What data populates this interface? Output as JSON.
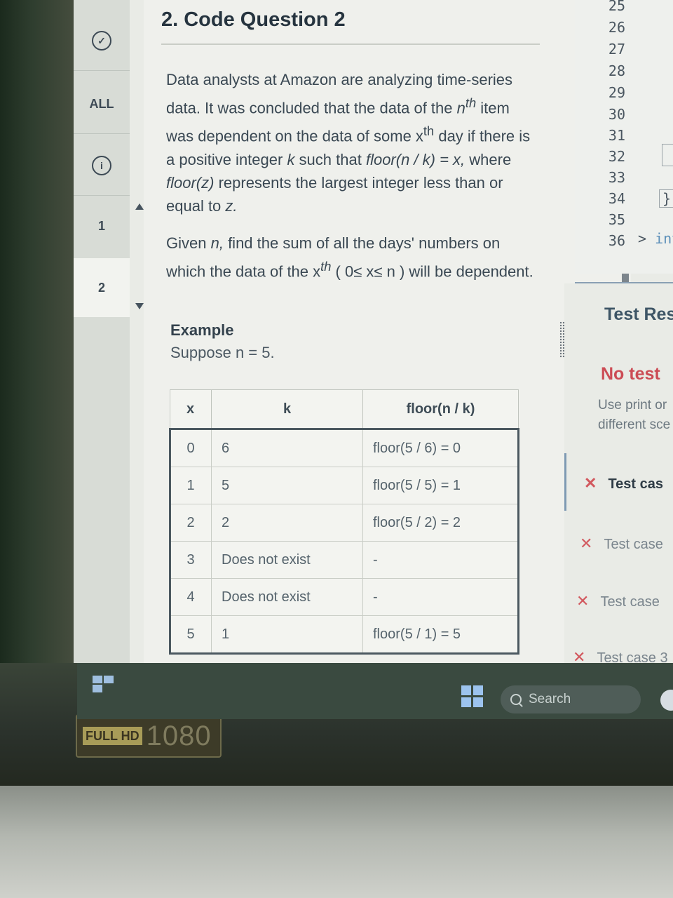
{
  "nav": {
    "all_label": "ALL",
    "item_1": "1",
    "item_2": "2"
  },
  "question": {
    "title": "2. Code Question 2",
    "p1_a": "Data analysts at Amazon are analyzing time-series data. It was concluded that the data of the ",
    "p1_n": "n",
    "p1_th": "th",
    "p1_b": " item was dependent on the data of some x",
    "p1_xth": "th",
    "p1_c": " day if there is a positive integer ",
    "p1_k": "k",
    "p1_d": " such that ",
    "p1_formula": "floor(n / k) = x,",
    "p1_e": " where ",
    "p1_floorz": "floor(z)",
    "p1_f": " represents the largest integer less than or equal to ",
    "p1_z": "z.",
    "p2_a": "Given ",
    "p2_n": "n,",
    "p2_b": " find the sum of all the days' numbers on which the data of the x",
    "p2_th": "th",
    "p2_c": " ( 0≤  x≤ n ) will be dependent.",
    "example_title": "Example",
    "example_sub": "Suppose n = 5."
  },
  "table": {
    "headers": [
      "x",
      "k",
      "floor(n / k)"
    ],
    "rows": [
      [
        "0",
        "6",
        "floor(5 / 6) = 0"
      ],
      [
        "1",
        "5",
        "floor(5 / 5) = 1"
      ],
      [
        "2",
        "2",
        "floor(5 / 2) = 2"
      ],
      [
        "3",
        "Does not exist",
        "-"
      ],
      [
        "4",
        "Does not exist",
        "-"
      ],
      [
        "5",
        "1",
        "floor(5 / 1) = 5"
      ]
    ]
  },
  "editor": {
    "line_numbers": [
      "25",
      "26",
      "27",
      "28",
      "29",
      "30",
      "31",
      "32",
      "33",
      "34",
      "35",
      "36"
    ],
    "line34_code": "}",
    "line36_arrow": ">",
    "line36_code": "int"
  },
  "results": {
    "heading": "Test Res",
    "no_test": "No test",
    "hint_line1": "Use print or",
    "hint_line2": "different sce",
    "cases": [
      "Test cas",
      "Test case",
      "Test case",
      "Test case 3"
    ]
  },
  "taskbar": {
    "search_label": "Search"
  },
  "hardware": {
    "badge_top": "FULL HD",
    "badge_res": "1080"
  },
  "colors": {
    "accent_blue": "#7e9ab3",
    "error_red": "#d2585e",
    "title_text": "#26343f"
  }
}
